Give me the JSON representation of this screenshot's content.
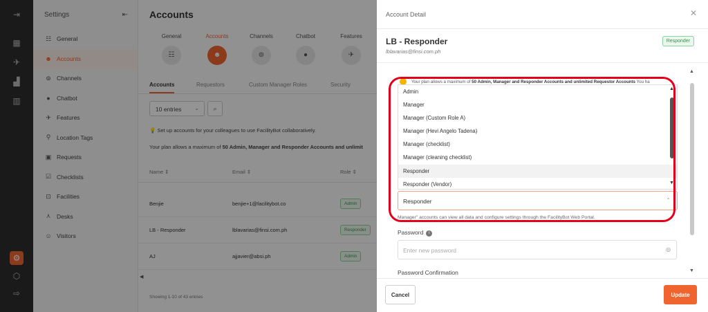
{
  "rail": {
    "icons": [
      "collapse-icon",
      "dashboard-icon",
      "map-icon",
      "bar-chart-icon",
      "stats-icon",
      "settings-icon",
      "box-icon",
      "logout-icon"
    ]
  },
  "sidebar": {
    "title": "Settings",
    "items": [
      {
        "label": "General"
      },
      {
        "label": "Accounts"
      },
      {
        "label": "Channels"
      },
      {
        "label": "Chatbot"
      },
      {
        "label": "Features"
      },
      {
        "label": "Location Tags"
      },
      {
        "label": "Requests"
      },
      {
        "label": "Checklists"
      },
      {
        "label": "Facilities"
      },
      {
        "label": "Desks"
      },
      {
        "label": "Visitors"
      }
    ]
  },
  "main": {
    "title": "Accounts",
    "categories": [
      {
        "label": "General"
      },
      {
        "label": "Accounts"
      },
      {
        "label": "Channels"
      },
      {
        "label": "Chatbot"
      },
      {
        "label": "Features"
      }
    ],
    "subtabs": [
      {
        "label": "Accounts"
      },
      {
        "label": "Requestors"
      },
      {
        "label": "Custom Manager Roles"
      },
      {
        "label": "Security"
      }
    ],
    "entries_label": "10 entries",
    "tip": "Set up accounts for your colleagues to use FacilityBot collaboratively.",
    "plan_prefix": "Your plan allows a maximum of ",
    "plan_bold": "50 Admin, Manager and Responder Accounts and unlimit",
    "columns": {
      "name": "Name",
      "email": "Email",
      "role": "Role"
    },
    "rows": [
      {
        "name": "Benjie",
        "email": "benjie+1@facilitybot.co",
        "role": "Admin"
      },
      {
        "name": "LB - Responder",
        "email": "lblavarias@finsi.com.ph",
        "role": "Responder"
      },
      {
        "name": "AJ",
        "email": "ajjavier@absi.ph",
        "role": "Admin"
      }
    ],
    "showing": "Showing 1-10 of 43 entries"
  },
  "drawer": {
    "title": "Account Detail",
    "name": "LB - Responder",
    "email": "lblavarias@finsi.com.ph",
    "badge": "Responder",
    "plan_prefix": "Your plan allows a maximum of ",
    "plan_bold": "50 Admin, Manager and Responder Accounts and unlimited Requestor Accounts",
    "plan_suffix": " You ha",
    "role_options": [
      "Admin",
      "Manager",
      "Manager (Custom Role A)",
      "Manager (Hevi Angelo Tadena)",
      "Manager (checklist)",
      "Manager (cleaning checklist)",
      "Responder",
      "Responder (Vendor)"
    ],
    "role_value": "Responder",
    "role_note": "Manager\" accounts can view all data and configure settings through the FacilityBot Web Portal.",
    "password_label": "Password",
    "password_placeholder": "Enter new password",
    "password_confirm_label": "Password Confirmation",
    "cancel_label": "Cancel",
    "update_label": "Update"
  },
  "colors": {
    "accent": "#f0652f",
    "highlight_ring": "#e3001b",
    "badge_green": "#3d8f50"
  }
}
